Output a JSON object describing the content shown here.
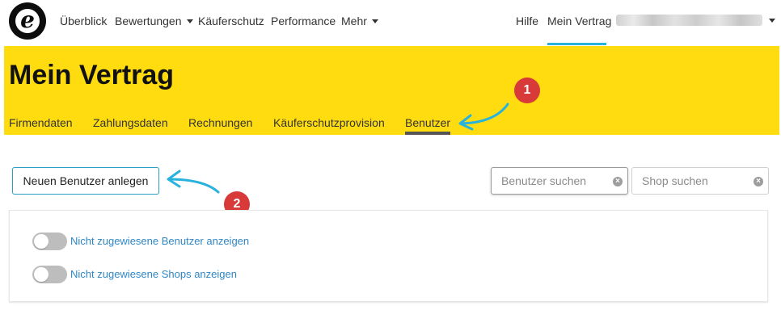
{
  "brand": {
    "logo_letter": "e"
  },
  "topnav": {
    "items": [
      {
        "label": "Überblick"
      },
      {
        "label": "Bewertungen"
      },
      {
        "label": "Käuferschutz"
      },
      {
        "label": "Performance"
      },
      {
        "label": "Mehr"
      }
    ],
    "help_label": "Hilfe",
    "contract_label": "Mein Vertrag",
    "active_item": "Mein Vertrag"
  },
  "header": {
    "title": "Mein Vertrag",
    "tabs": [
      {
        "label": "Firmendaten"
      },
      {
        "label": "Zahlungsdaten"
      },
      {
        "label": "Rechnungen"
      },
      {
        "label": "Käuferschutzprovision"
      },
      {
        "label": "Benutzer"
      }
    ],
    "active_tab": "Benutzer"
  },
  "annotations": [
    {
      "number": "1"
    },
    {
      "number": "2"
    }
  ],
  "actions": {
    "new_user_label": "Neuen Benutzer anlegen"
  },
  "search": {
    "user_placeholder": "Benutzer suchen",
    "user_value": "",
    "shop_placeholder": "Shop suchen",
    "shop_value": ""
  },
  "filters": [
    {
      "label": "Nicht zugewiesene Benutzer anzeigen",
      "enabled": false
    },
    {
      "label": "Nicht zugewiesene Shops anzeigen",
      "enabled": false
    }
  ],
  "icons": {
    "logo": "trusted-shops-e-logo",
    "dropdown": "caret-down-icon",
    "clear": "clear-circle-icon",
    "annotation_arrow": "curved-arrow-icon"
  },
  "colors": {
    "header_yellow": "#ffdc0f",
    "accent_blue": "#29b3dc",
    "link_blue": "#2f86c4",
    "badge_red": "#d83a3a",
    "tab_underline": "#555555"
  }
}
